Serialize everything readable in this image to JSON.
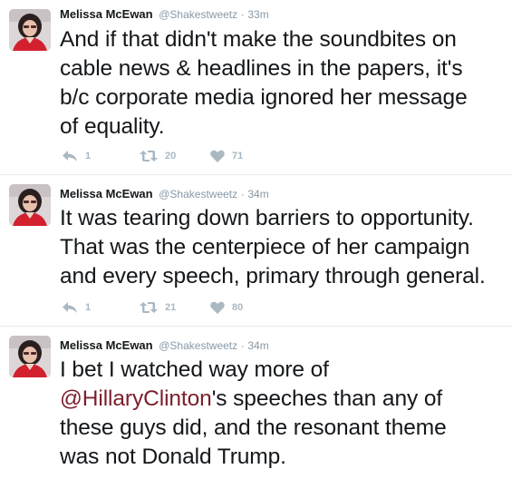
{
  "tweets": [
    {
      "name": "Melissa McEwan",
      "handle": "@Shakestweetz",
      "separator": "·",
      "time": "33m",
      "text_lines": [
        "And if that didn't make the soundbites on",
        "cable news & headlines in the papers, it's",
        "b/c corporate media ignored her message",
        "of equality."
      ],
      "reply_count": "1",
      "retweet_count": "20",
      "like_count": "71"
    },
    {
      "name": "Melissa McEwan",
      "handle": "@Shakestweetz",
      "separator": "·",
      "time": "34m",
      "text_lines": [
        "It was tearing down barriers to opportunity.",
        "That was the centerpiece of her campaign",
        "and every speech, primary through general."
      ],
      "reply_count": "1",
      "retweet_count": "21",
      "like_count": "80"
    },
    {
      "name": "Melissa McEwan",
      "handle": "@Shakestweetz",
      "separator": "·",
      "time": "34m",
      "text_line1": "I bet I watched way more of",
      "mention": "@HillaryClinton",
      "mention_suffix": "'s speeches than any of",
      "text_line3": "these guys did, and the resonant theme",
      "text_line4": "was not Donald Trump."
    }
  ],
  "icons": {
    "reply": "reply-icon",
    "retweet": "retweet-icon",
    "like": "heart-icon"
  },
  "colors": {
    "action_gray": "#aab8c2",
    "meta_gray": "#8899a6",
    "mention": "#7b1f2b",
    "text": "#14171a"
  }
}
